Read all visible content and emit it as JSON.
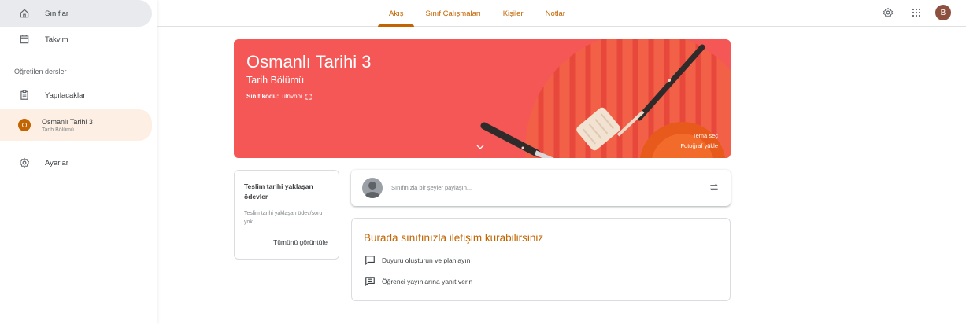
{
  "sidebar": {
    "items": [
      {
        "label": "Sınıflar",
        "icon": "home-icon"
      },
      {
        "label": "Takvim",
        "icon": "calendar-icon"
      }
    ],
    "section_label": "Öğretilen dersler",
    "todo": {
      "label": "Yapılacaklar",
      "icon": "assignment-icon"
    },
    "active_class": {
      "initial": "O",
      "name": "Osmanlı Tarihi 3",
      "section": "Tarih Bölümü",
      "color": "#c26401"
    },
    "settings": {
      "label": "Ayarlar",
      "icon": "gear-icon"
    }
  },
  "topbar": {
    "tabs": [
      {
        "label": "Akış",
        "selected": true
      },
      {
        "label": "Sınıf Çalışmaları",
        "selected": false
      },
      {
        "label": "Kişiler",
        "selected": false
      },
      {
        "label": "Notlar",
        "selected": false
      }
    ],
    "accent_color": "#c26401",
    "icons": [
      "gear-icon",
      "apps-grid-icon"
    ],
    "avatar_initial": "B"
  },
  "banner": {
    "title": "Osmanlı Tarihi 3",
    "subtitle": "Tarih Bölümü",
    "code_label": "Sınıf kodu:",
    "code_value": "ulnvhoi",
    "theme_link": "Tema seç",
    "photo_link": "Fotoğraf yükle",
    "color": "#f55656"
  },
  "upcoming": {
    "title": "Teslim tarihi yaklaşan ödevler",
    "empty": "Teslim tarihi yaklaşan ödev/soru yok",
    "view_all": "Tümünü görüntüle"
  },
  "share": {
    "placeholder": "Sınıfınızla bir şeyler paylaşın..."
  },
  "info": {
    "heading": "Burada sınıfınızla iletişim kurabilirsiniz",
    "announce": "Duyuru oluşturun ve planlayın",
    "reply": "Öğrenci yayınlarına yanıt verin"
  }
}
